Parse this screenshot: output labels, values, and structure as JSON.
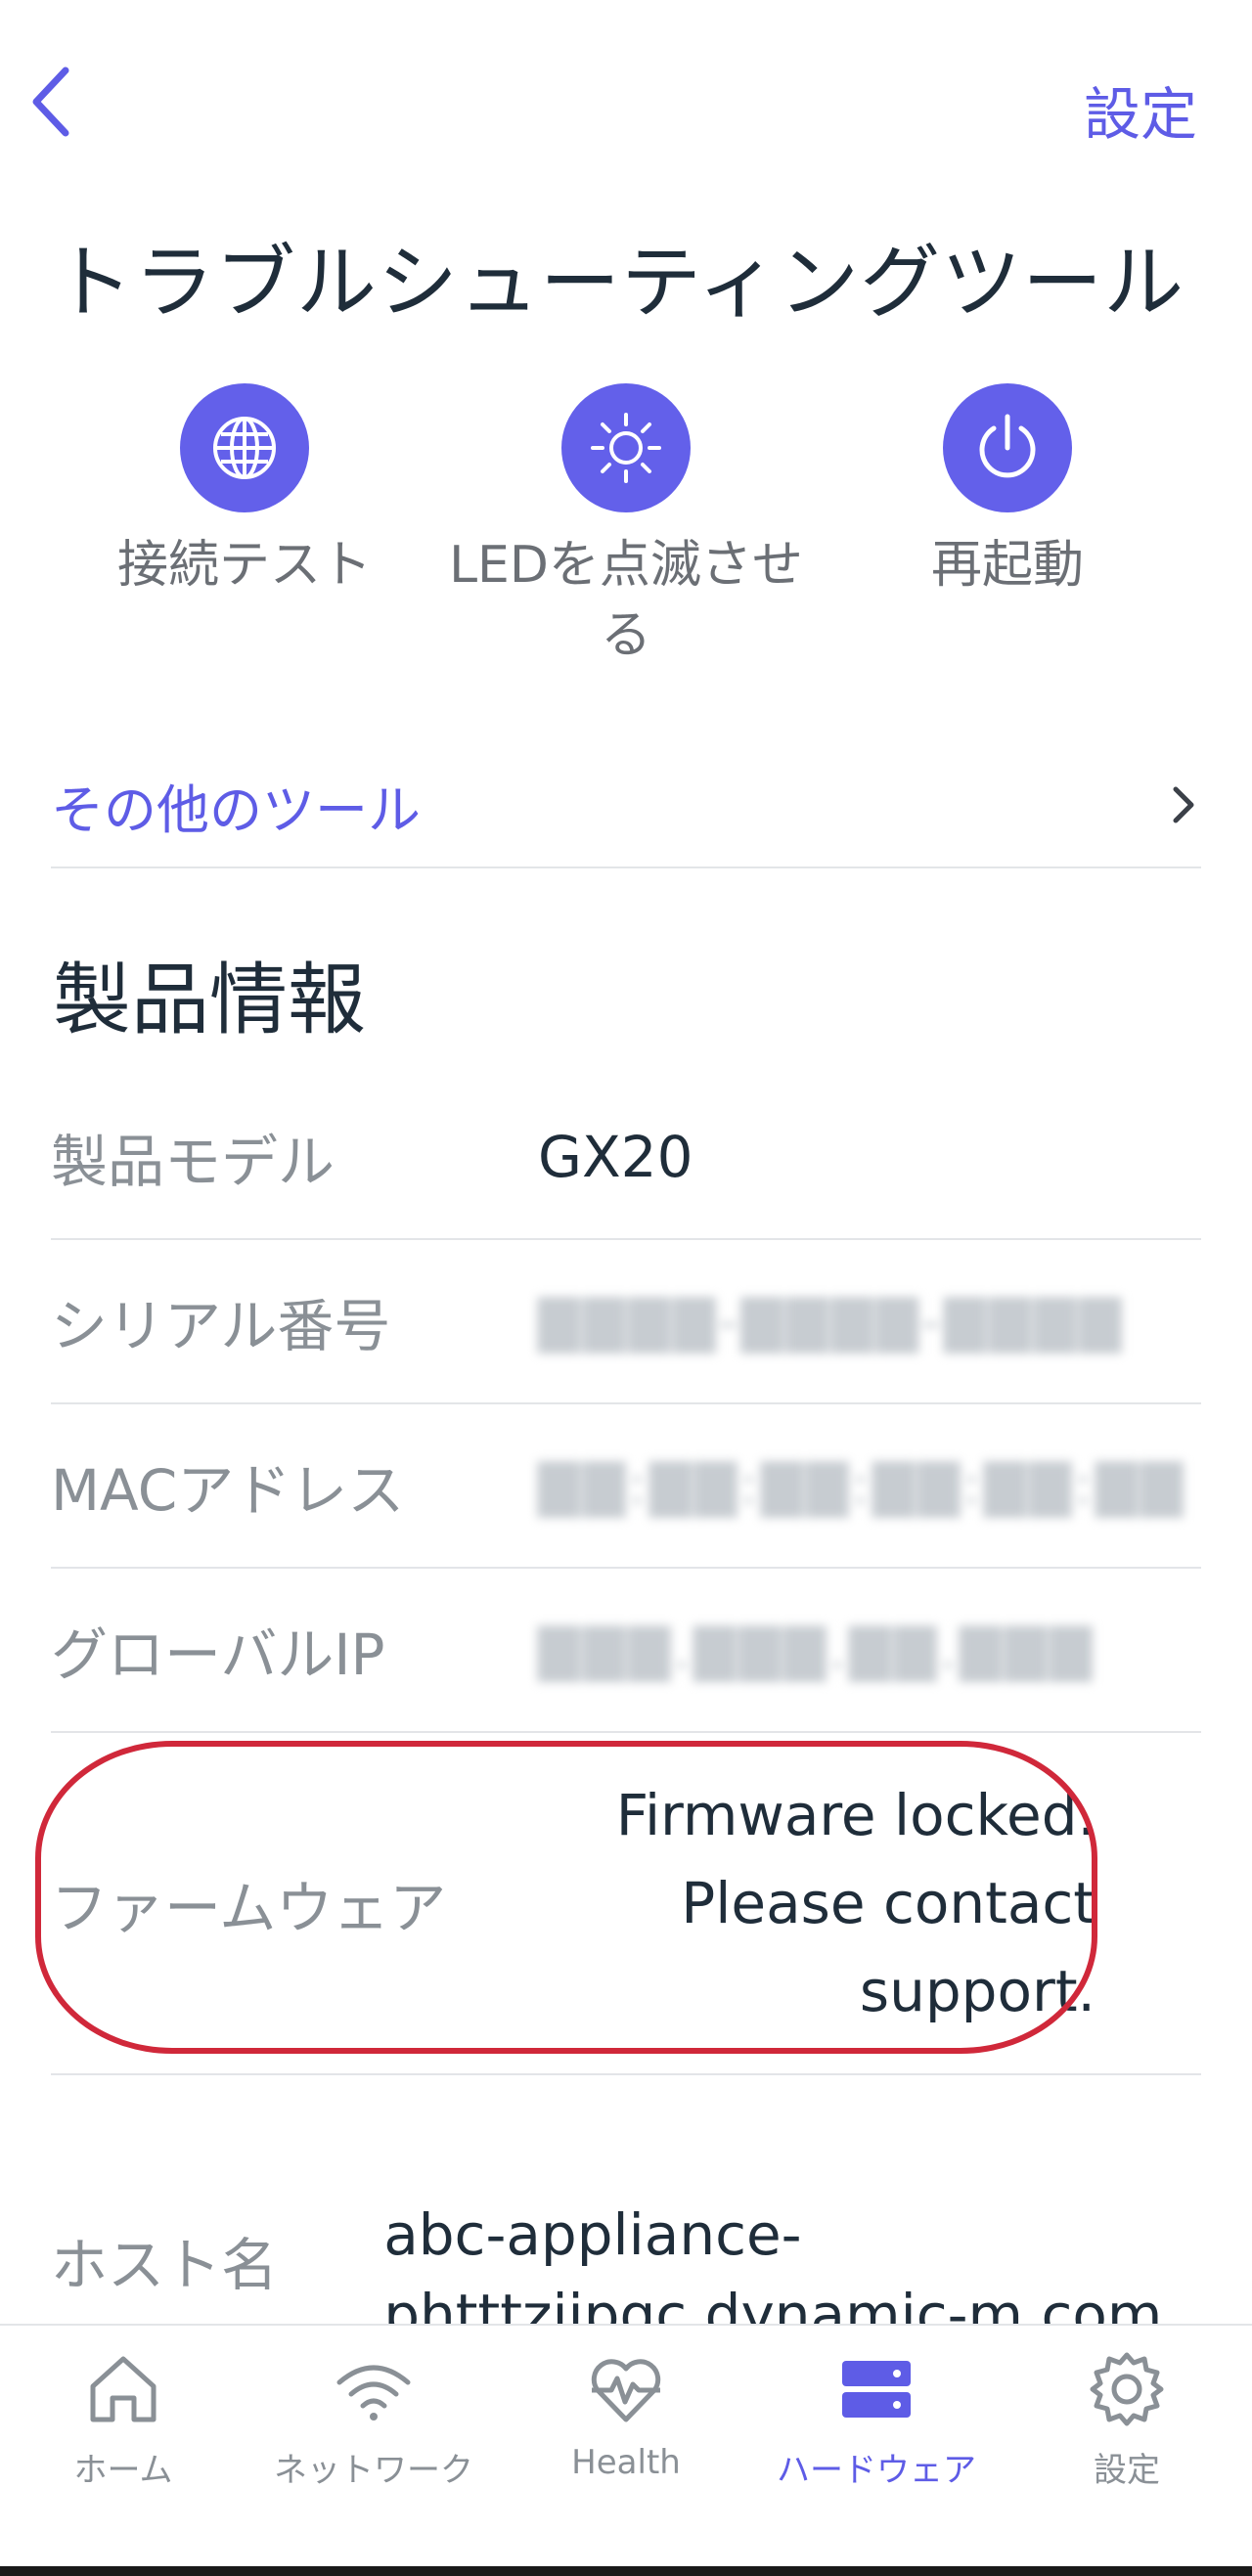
{
  "header": {
    "settings_label": "設定",
    "title": "トラブルシューティングツール"
  },
  "tools": [
    {
      "label": "接続テスト",
      "icon": "globe-icon"
    },
    {
      "label": "LEDを点滅させる",
      "icon": "led-brightness-icon"
    },
    {
      "label": "再起動",
      "icon": "power-icon"
    }
  ],
  "more_tools": {
    "label": "その他のツール"
  },
  "product_info": {
    "title": "製品情報",
    "rows": [
      {
        "key": "製品モデル",
        "value": "GX20"
      },
      {
        "key": "シリアル番号",
        "value": ""
      },
      {
        "key": "MACアドレス",
        "value": ""
      },
      {
        "key": "グローバルIP",
        "value": ""
      },
      {
        "key": "ファームウェア",
        "value": "Firmware locked. Please contact support."
      },
      {
        "key": "ホスト名",
        "value": "abc-appliance-phtttzjjpgc.dynamic-m.com"
      }
    ]
  },
  "tabbar": {
    "items": [
      {
        "label": "ホーム",
        "icon": "home-icon",
        "active": false
      },
      {
        "label": "ネットワーク",
        "icon": "wifi-icon",
        "active": false
      },
      {
        "label": "Health",
        "icon": "health-heart-icon",
        "active": false
      },
      {
        "label": "ハードウェア",
        "icon": "server-icon",
        "active": true
      },
      {
        "label": "設定",
        "icon": "gear-icon",
        "active": false
      }
    ]
  },
  "colors": {
    "accent": "#5e5ce6",
    "highlight": "#d0283a",
    "muted": "#8a9096",
    "text": "#1f2d3a"
  }
}
